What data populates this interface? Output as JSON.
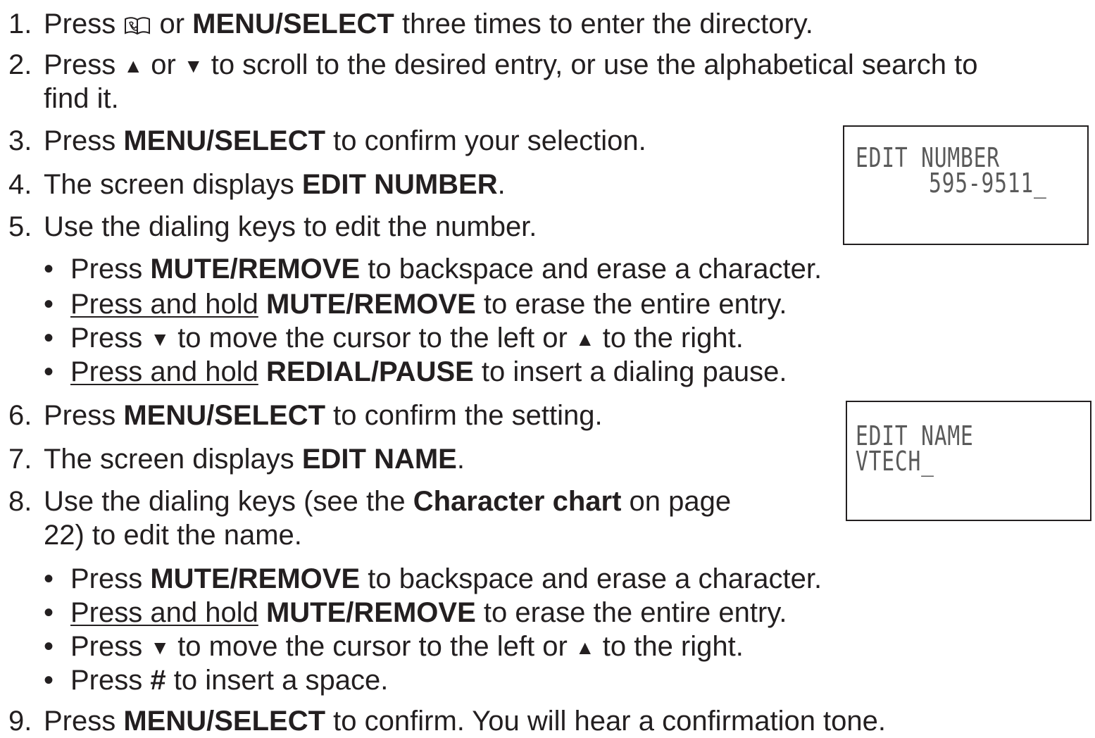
{
  "steps": {
    "s1": {
      "num": "1.",
      "pre": "Press ",
      "mid": " or ",
      "bold": "MENU/SELECT",
      "post": " three times to enter the directory."
    },
    "s2": {
      "num": "2.",
      "pre": "Press ",
      "up": "▲",
      "or": " or ",
      "down": "▼",
      "post": " to scroll to the desired entry, or use the alphabetical search to",
      "cont": "find it."
    },
    "s3": {
      "num": "3.",
      "pre": "Press ",
      "bold": "MENU/SELECT",
      "post": " to confirm your selection."
    },
    "s4": {
      "num": "4.",
      "pre": "The screen displays ",
      "bold": "EDIT NUMBER",
      "post": "."
    },
    "s5": {
      "num": "5.",
      "text": "Use the dialing keys to edit the number."
    },
    "s6": {
      "num": "6.",
      "pre": "Press ",
      "bold": "MENU/SELECT",
      "post": " to confirm the setting."
    },
    "s7": {
      "num": "7.",
      "pre": "The screen displays ",
      "bold": "EDIT NAME",
      "post": "."
    },
    "s8": {
      "num": "8.",
      "pre": "Use the dialing keys (see the ",
      "bold": "Character chart",
      "post": " on page",
      "cont": "22) to edit the name."
    },
    "s9": {
      "num": "9.",
      "pre": "Press ",
      "bold": "MENU/SELECT",
      "post": " to confirm. You will hear a confirmation tone."
    }
  },
  "bullets5": {
    "b1": {
      "dot": "•",
      "pre": "Press ",
      "bold": "MUTE/REMOVE",
      "post": " to backspace and erase a character."
    },
    "b2": {
      "dot": "•",
      "ul": "Press and hold",
      "sp": " ",
      "bold": "MUTE/REMOVE",
      "post": " to erase the entire entry."
    },
    "b3": {
      "dot": "•",
      "pre": "Press ",
      "down": "▼",
      "mid": " to move the cursor to the left or ",
      "up": "▲",
      "post": " to the right."
    },
    "b4": {
      "dot": "•",
      "ul": "Press and hold",
      "sp": " ",
      "bold": "REDIAL/PAUSE",
      "post": " to insert a dialing pause."
    }
  },
  "bullets8": {
    "b1": {
      "dot": "•",
      "pre": "Press ",
      "bold": "MUTE/REMOVE",
      "post": " to backspace and erase a character."
    },
    "b2": {
      "dot": "•",
      "ul": "Press and hold",
      "sp": " ",
      "bold": "MUTE/REMOVE",
      "post": " to erase the entire entry."
    },
    "b3": {
      "dot": "•",
      "pre": "Press ",
      "down": "▼",
      "mid": " to move the cursor to the left or ",
      "up": "▲",
      "post": " to the right."
    },
    "b4": {
      "dot": "•",
      "pre": "Press ",
      "bold": "#",
      "post": " to insert a space."
    }
  },
  "screens": {
    "number": {
      "line1": "EDIT NUMBER",
      "line2": "595-9511_"
    },
    "name": {
      "line1": "EDIT NAME",
      "line2": "VTECH_"
    }
  },
  "icons": {
    "directory": "directory-book-icon"
  }
}
